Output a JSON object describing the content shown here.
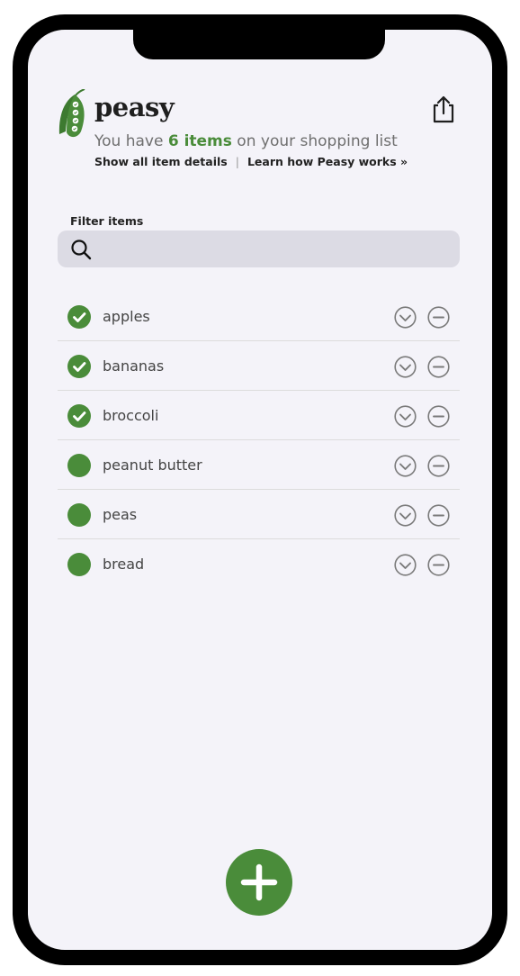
{
  "header": {
    "brand": "peasy",
    "summary_prefix": "You have ",
    "item_count_text": "6 items",
    "summary_suffix": " on your shopping list",
    "show_details_link": "Show all item details",
    "links_separator": "|",
    "learn_link": "Learn how Peasy works »"
  },
  "filter": {
    "label": "Filter items",
    "value": "",
    "placeholder": ""
  },
  "items": [
    {
      "name": "apples",
      "checked": true
    },
    {
      "name": "bananas",
      "checked": true
    },
    {
      "name": "broccoli",
      "checked": true
    },
    {
      "name": "peanut butter",
      "checked": false
    },
    {
      "name": "peas",
      "checked": false
    },
    {
      "name": "bread",
      "checked": false
    }
  ],
  "icons": {
    "logo": "pea-pod-icon",
    "share": "share-icon",
    "search": "search-icon",
    "check": "check-icon",
    "expand": "chevron-down-circle-icon",
    "remove": "minus-circle-icon",
    "add": "plus-icon"
  },
  "colors": {
    "accent": "#4a8c3a",
    "background": "#f4f3f9",
    "search_background": "#dcdbe4",
    "text": "#444444",
    "icon_gray": "#7a7a7a"
  }
}
